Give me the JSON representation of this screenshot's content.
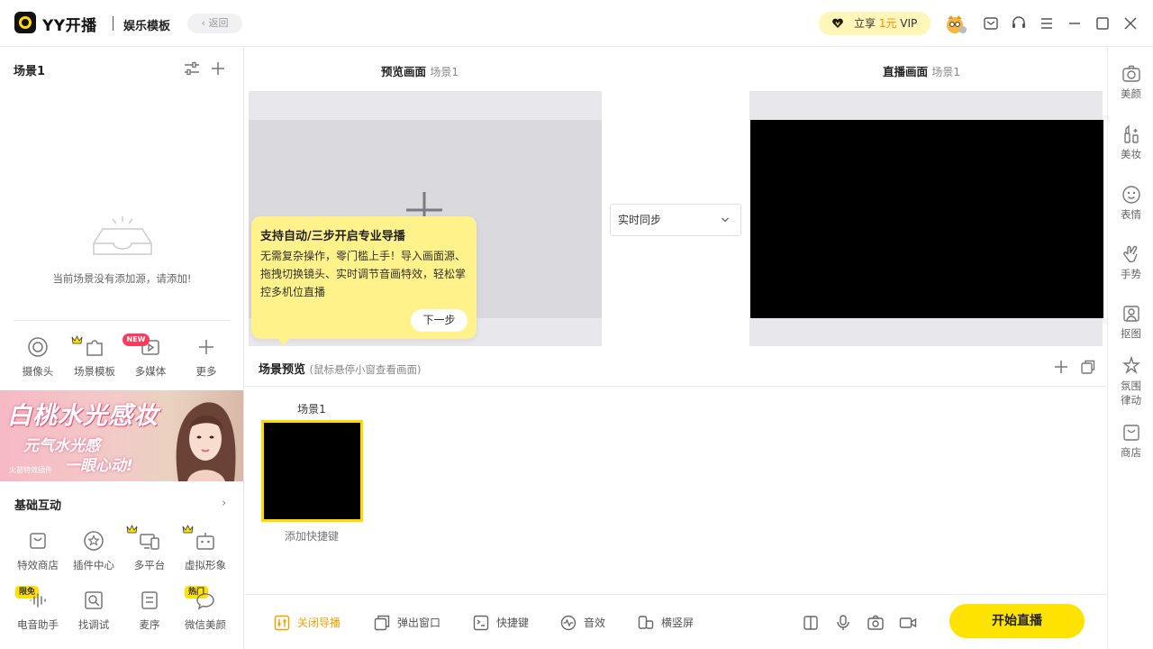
{
  "titlebar": {
    "app_name": "YY开播",
    "mode": "娱乐模板",
    "back_label": "返回",
    "vip_prefix": "立享 ",
    "vip_price": "1元",
    "vip_suffix": " VIP"
  },
  "left": {
    "scene_title": "场景1",
    "empty_text": "当前场景没有添加源，请添加!",
    "tools": [
      {
        "label": "摄像头",
        "icon": "camera-icon"
      },
      {
        "label": "场景模板",
        "icon": "puzzle-icon"
      },
      {
        "label": "多媒体",
        "icon": "media-icon"
      },
      {
        "label": "更多",
        "icon": "plus-icon"
      }
    ],
    "new_badge": "NEW",
    "banner": {
      "line1": "白桃水光感妆",
      "line2": "元气水光感",
      "line3": "一眼心动!",
      "small": "火苗特效插件"
    },
    "section_title": "基础互动",
    "section_arrow": "›",
    "interact": [
      {
        "label": "特效商店",
        "icon": "shop-bag-icon"
      },
      {
        "label": "插件中心",
        "icon": "star-circle-icon"
      },
      {
        "label": "多平台",
        "icon": "multi-screen-icon"
      },
      {
        "label": "虚拟形象",
        "icon": "robot-icon"
      },
      {
        "label": "电音助手",
        "icon": "sound-wave-icon"
      },
      {
        "label": "找调试",
        "icon": "debug-icon"
      },
      {
        "label": "麦序",
        "icon": "list-icon"
      },
      {
        "label": "微信美颜",
        "icon": "wechat-icon"
      }
    ],
    "tag_free": "限免",
    "tag_hot": "热门"
  },
  "preview": {
    "preview_label": "预览画面",
    "preview_scene": "场景1",
    "live_label": "直播画面",
    "live_scene": "场景1",
    "sync_value": "实时同步"
  },
  "tooltip": {
    "title": "支持自动/三步开启专业导播",
    "body": "无需复杂操作，零门槛上手！导入画面源、拖拽切换镜头、实时调节音画特效，轻松掌控多机位直播",
    "next_label": "下一步"
  },
  "scene_preview": {
    "title": "场景预览",
    "hint": "(鼠标悬停小窗查看画面)",
    "scene_name": "场景1",
    "add_shortcut": "添加快捷键"
  },
  "bottombar": {
    "items": [
      {
        "label": "关闭导播",
        "icon": "sliders-icon"
      },
      {
        "label": "弹出窗口",
        "icon": "popout-icon"
      },
      {
        "label": "快捷键",
        "icon": "keyboard-icon"
      },
      {
        "label": "音效",
        "icon": "sound-effect-icon"
      },
      {
        "label": "横竖屏",
        "icon": "rotate-screen-icon"
      }
    ],
    "start_label": "开始直播"
  },
  "rightbar": {
    "items": [
      {
        "label": "美颜",
        "icon": "beauty-icon"
      },
      {
        "label": "美妆",
        "icon": "makeup-icon"
      },
      {
        "label": "表情",
        "icon": "emoji-icon"
      },
      {
        "label": "手势",
        "icon": "gesture-icon"
      },
      {
        "label": "抠图",
        "icon": "matting-icon"
      },
      {
        "label": "氛围律动",
        "icon": "atmosphere-icon"
      },
      {
        "label": "商店",
        "icon": "store-icon"
      }
    ]
  },
  "colors": {
    "brand_yellow": "#ffe300",
    "accent_orange": "#f5a000",
    "tooltip_bg": "#fff28a",
    "new_badge": "#ff3b5c"
  }
}
